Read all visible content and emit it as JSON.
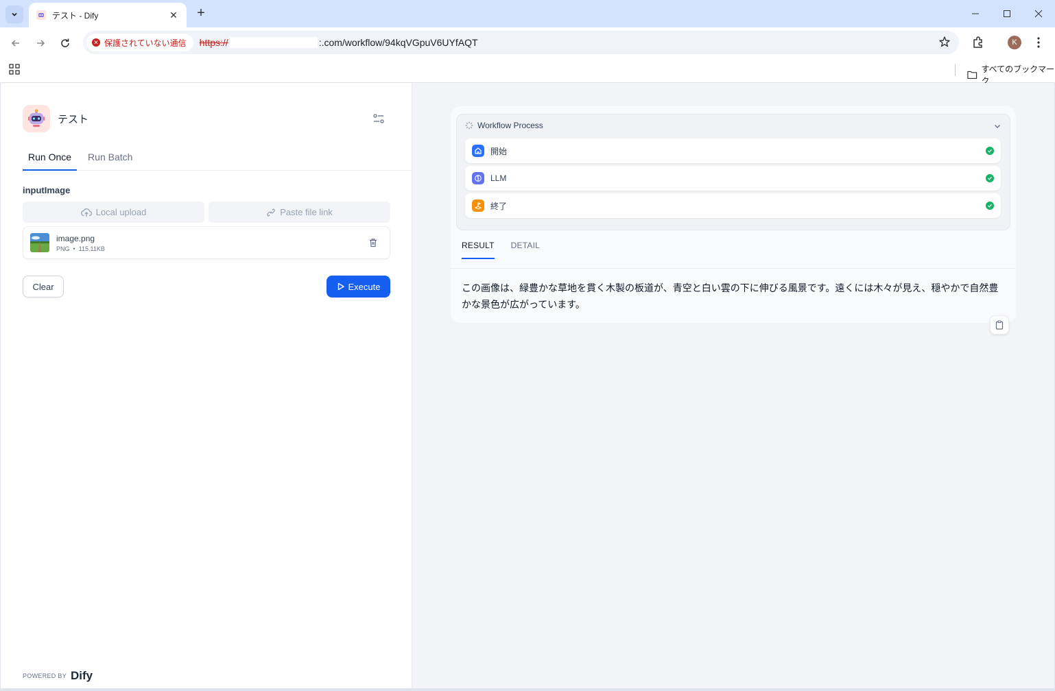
{
  "browser": {
    "tab_title": "テスト  - Dify",
    "security_label": "保護されていない通信",
    "url_scheme": "https://",
    "url_rest": ":.com/workflow/94kqVGpuV6UYfAQT",
    "bookmarks_label": "すべてのブックマーク",
    "profile_initial": "K"
  },
  "app": {
    "name": "テスト",
    "tabs": [
      {
        "label": "Run Once",
        "active": true
      },
      {
        "label": "Run Batch",
        "active": false
      }
    ],
    "input": {
      "label": "inputImage",
      "local_upload": "Local upload",
      "paste_link": "Paste file link"
    },
    "file": {
      "name": "image.png",
      "type": "PNG",
      "size": "115.11KB"
    },
    "clear_label": "Clear",
    "execute_label": "Execute",
    "powered_by": "POWERED BY",
    "brand": "Dify"
  },
  "workflow": {
    "title": "Workflow Process",
    "nodes": [
      {
        "title": "開始",
        "color": "#2970ff",
        "status": "succeeded"
      },
      {
        "title": "LLM",
        "color": "#6172f3",
        "status": "succeeded"
      },
      {
        "title": "終了",
        "color": "#f79009",
        "status": "succeeded"
      }
    ]
  },
  "result": {
    "tabs": [
      {
        "label": "RESULT",
        "active": true
      },
      {
        "label": "DETAIL",
        "active": false
      }
    ],
    "text": "この画像は、緑豊かな草地を貫く木製の板道が、青空と白い雲の下に伸びる風景です。遠くには木々が見え、穏やかで自然豊かな景色が広がっています。"
  },
  "colors": {
    "accent": "#155eef",
    "success": "#17b26a"
  }
}
